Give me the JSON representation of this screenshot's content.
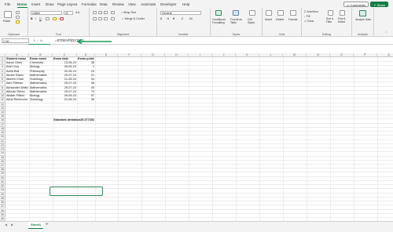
{
  "tabs": [
    "File",
    "Home",
    "Insert",
    "Draw",
    "Page Layout",
    "Formulas",
    "Data",
    "Review",
    "View",
    "Automate",
    "Developer",
    "Help"
  ],
  "topbar": {
    "comments_label": "Comments",
    "share_label": "Share"
  },
  "ribbon": {
    "font_name": "Calibri",
    "font_size": "11",
    "number_format": "General",
    "paste_label": "Paste",
    "wrap_text_label": "Wrap Text",
    "merge_label": "Merge & Center",
    "conditional_formatting_label": "Conditional Formatting",
    "format_as_table_label": "Format as Table",
    "cell_styles_label": "Cell Styles",
    "insert_label": "Insert",
    "delete_label": "Delete",
    "format_label": "Format",
    "autosum_label": "AutoSum",
    "fill_label": "Fill",
    "clear_label": "Clear",
    "sort_filter_label": "Sort & Filter",
    "find_select_label": "Find & Select",
    "analyze_data_label": "Analyze Data",
    "groups": [
      "Clipboard",
      "Font",
      "Alignment",
      "Number",
      "Styles",
      "Cells",
      "Editing",
      "Analysis"
    ]
  },
  "formula_bar": {
    "name_box": "C16",
    "fx_label": "fx",
    "formula": "=STDEVP(D2:D11)"
  },
  "columns": [
    "A",
    "B",
    "C",
    "D",
    "E",
    "F",
    "G",
    "H",
    "I",
    "J",
    "K",
    "L",
    "M",
    "N",
    "O",
    "P",
    "Q",
    "R",
    "S",
    "T",
    "U"
  ],
  "row_numbers": [
    "1",
    "2",
    "3",
    "4",
    "5",
    "6",
    "7",
    "8",
    "9",
    "10",
    "11",
    "12",
    "13",
    "14",
    "15",
    "16",
    "17",
    "18",
    "19",
    "20",
    "21",
    "22",
    "23",
    "24",
    "25",
    "26",
    "27",
    "28",
    "29",
    "30",
    "31",
    "32",
    "33",
    "34",
    "35",
    "36",
    "37",
    "38",
    "39",
    "40"
  ],
  "table": {
    "headers": [
      "Student name",
      "Exam name",
      "Exam date",
      "Exam points"
    ],
    "rows": [
      [
        "Aaron Giles",
        "Chemistry",
        "15-06-24",
        "38"
      ],
      [
        "Abel Clay",
        "Biology",
        "05-06-24",
        "1"
      ],
      [
        "Adria Ball",
        "Philosophy",
        "02-06-24",
        "23"
      ],
      [
        "Aimee Eaton",
        "Mathematics",
        "29-07-24",
        "21"
      ],
      [
        "Akeem Chan",
        "Sociology",
        "21-06-24",
        "94"
      ],
      [
        "Alec Pittman",
        "Mathematics",
        "29-07-24",
        "36"
      ],
      [
        "Alexander Walton",
        "Mathematics",
        "29-07-24",
        "40"
      ],
      [
        "Alfonso Perez",
        "Mathematics",
        "29-07-24",
        "74"
      ],
      [
        "Alistair Patton",
        "Biology",
        "05-06-24",
        "57"
      ],
      [
        "Alma Richmond",
        "Sociology",
        "21-06-24",
        "35"
      ]
    ]
  },
  "stdev": {
    "label": "Standard deviation",
    "value": "25.377352"
  },
  "sheet": {
    "tab_label": "Sheet1",
    "add_label": "+"
  }
}
